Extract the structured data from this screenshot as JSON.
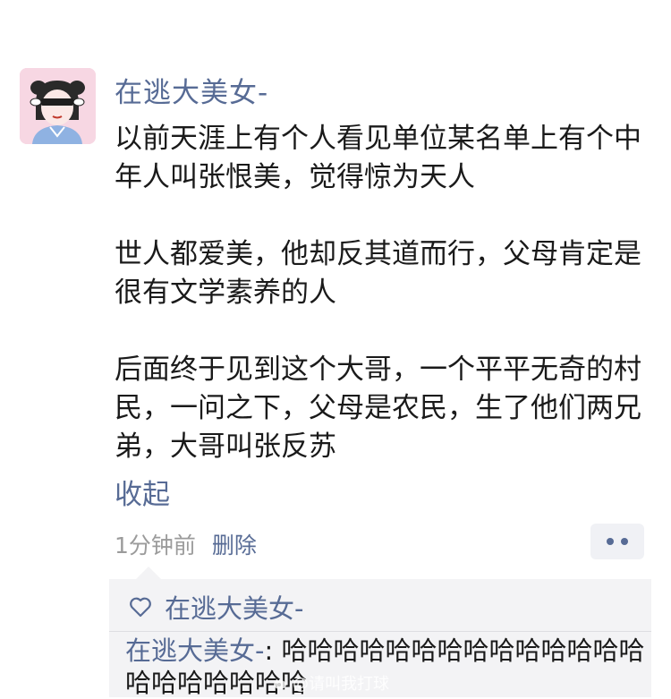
{
  "post": {
    "author": "在逃大美女-",
    "paragraphs": [
      "以前天涯上有个人看见单位某名单上有个中年人叫张恨美，觉得惊为天人",
      "世人都爱美，他却反其道而行，父母肯定是很有文学素养的人",
      "后面终于见到这个大哥，一个平平无奇的村民，一问之下，父母是农民，生了他们两兄弟，大哥叫张反苏"
    ],
    "collapse_label": "收起",
    "timestamp": "1分钟前",
    "delete_label": "删除"
  },
  "interactions": {
    "likes": "在逃大美女-",
    "comment": {
      "author": "在逃大美女-",
      "separator": ": ",
      "text": "哈哈哈哈哈哈哈哈哈哈哈哈哈哈哈哈哈哈哈哈哈"
    }
  },
  "watermark": "@请叫我打球",
  "icons": {
    "avatar": "cartoon-girl-avatar",
    "more": "more-dots-icon",
    "like": "heart-outline-icon",
    "watermark": "weibo-icon"
  },
  "colors": {
    "link": "#576b95",
    "text": "#1a1a1a",
    "muted": "#9b9b9b",
    "panel": "#f3f3f5",
    "avatar_bg": "#f7d7e3"
  }
}
